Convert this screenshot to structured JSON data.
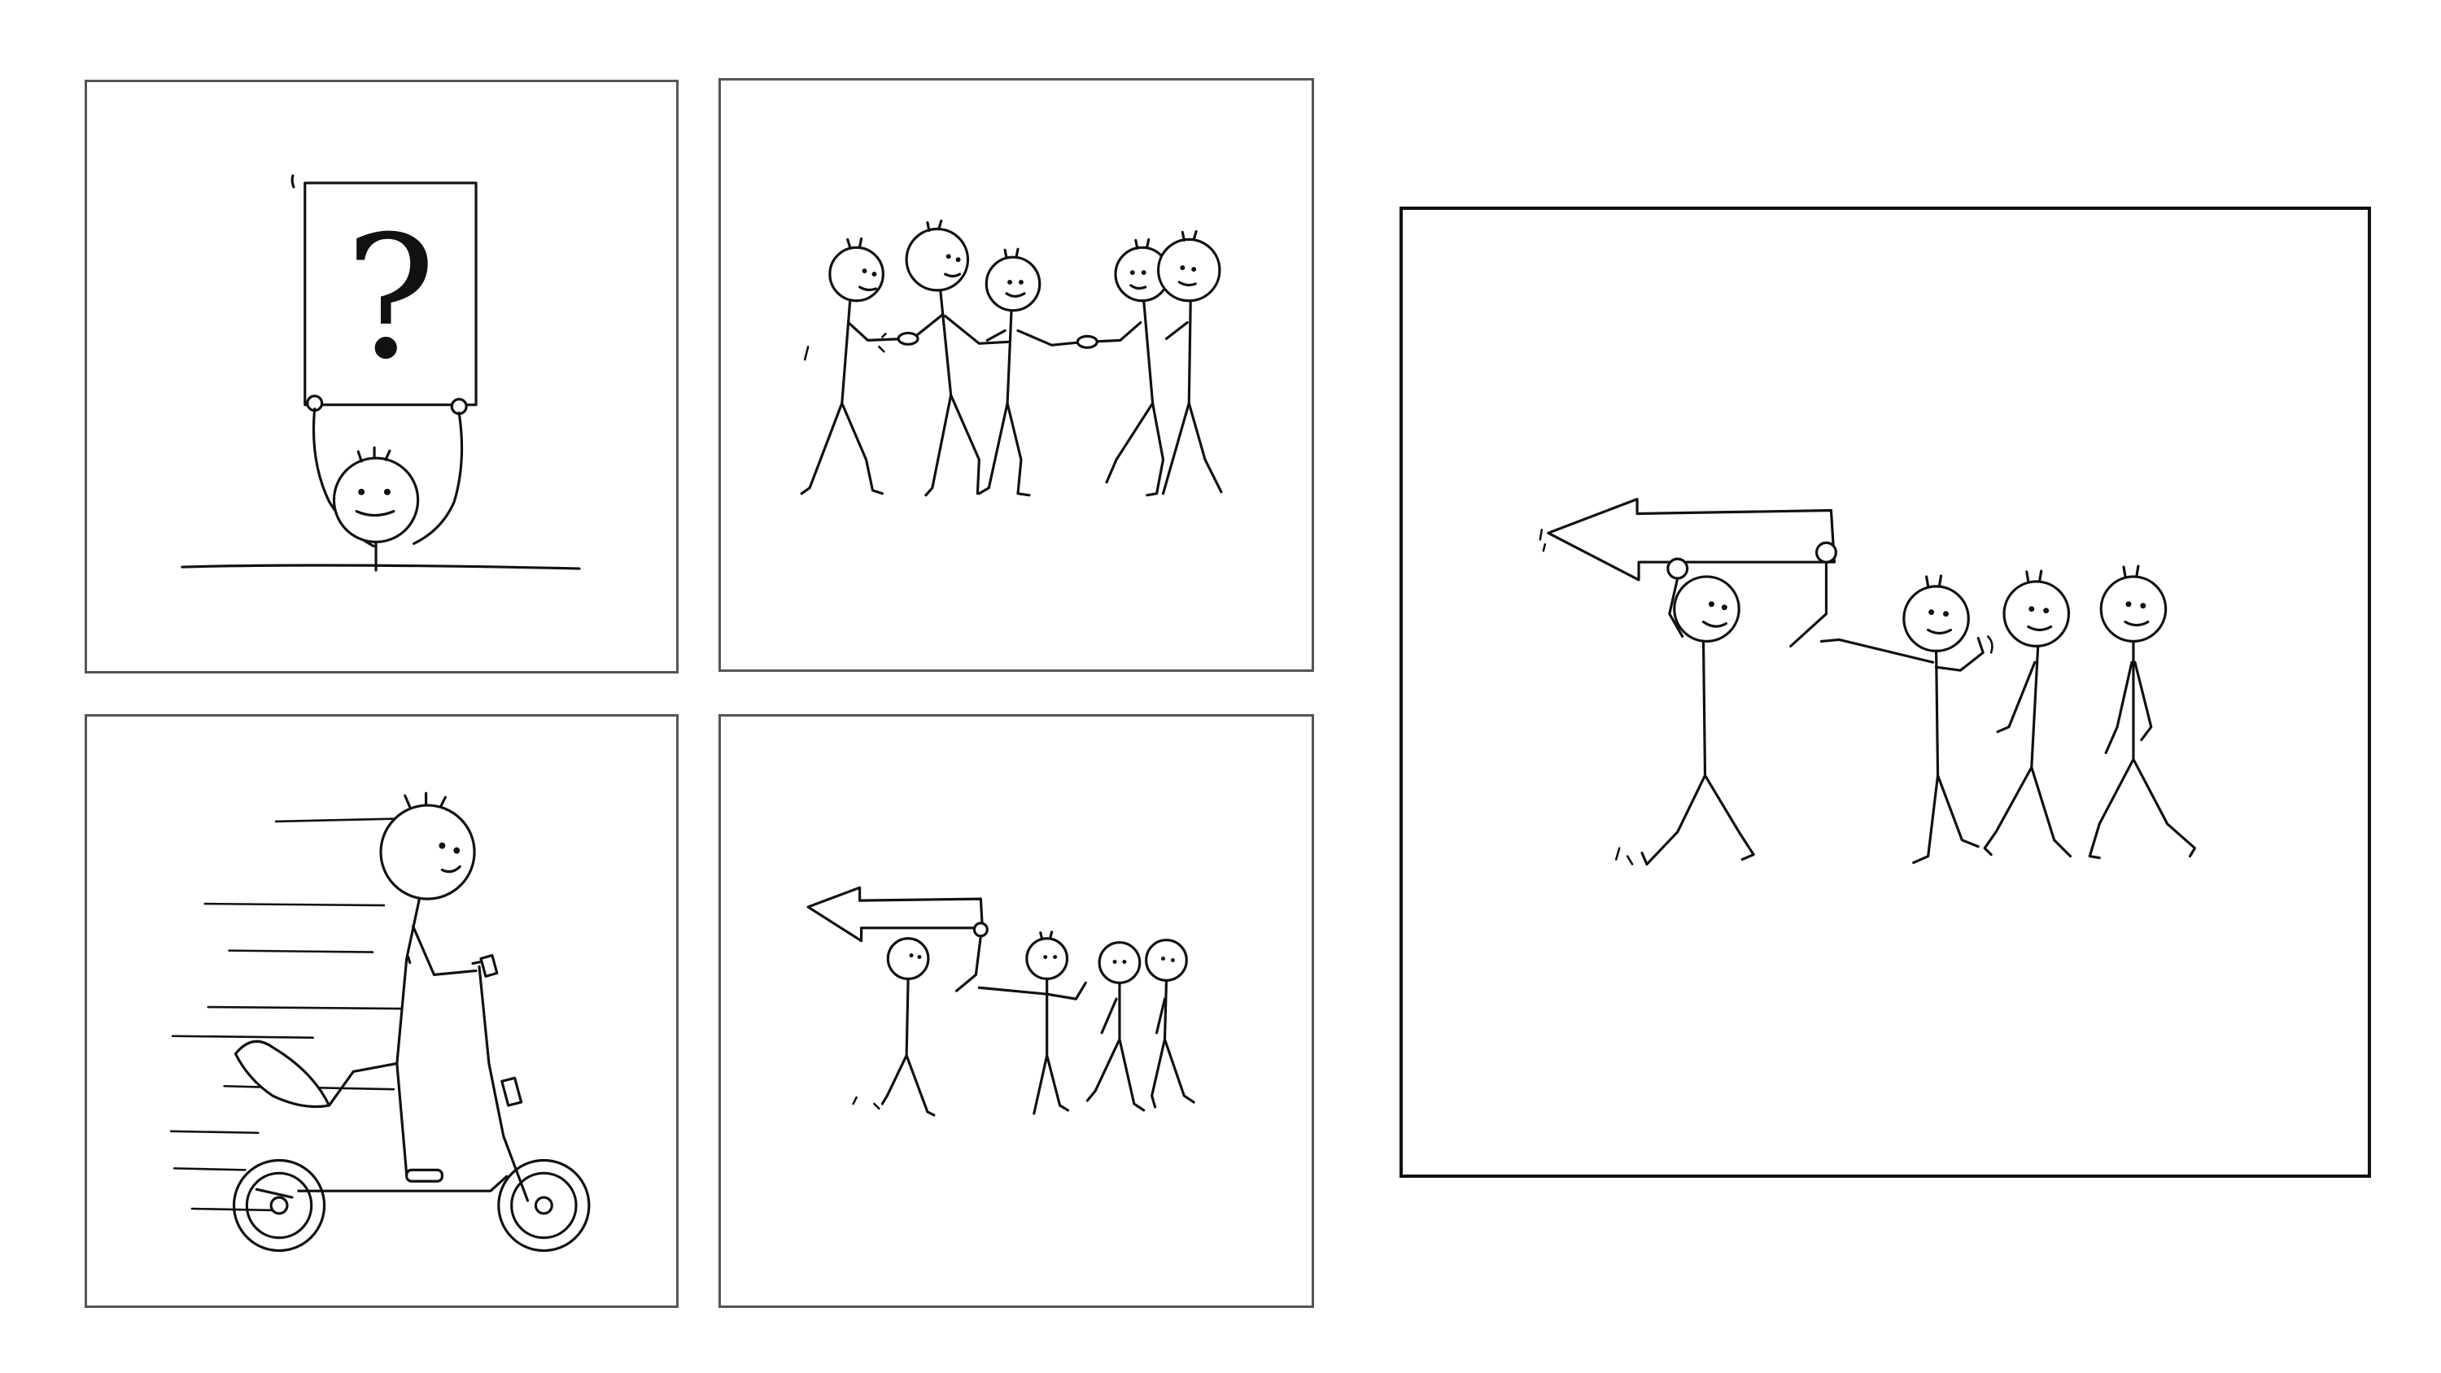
{
  "panels": [
    {
      "id": "question-sign",
      "sign_text": "?",
      "description_icon": "stick-figure-holding-sign-icon"
    },
    {
      "id": "group-holding-hands",
      "description_icon": "stick-figure-group-icon"
    },
    {
      "id": "scooter-rider",
      "description_icon": "stick-figure-scooter-icon"
    },
    {
      "id": "arrow-leader-small",
      "description_icon": "stick-figure-arrow-icon"
    },
    {
      "id": "arrow-leader-large",
      "description_icon": "stick-figure-arrow-icon"
    }
  ],
  "colors": {
    "ink": "#111111",
    "panel_border_small": "#555555",
    "panel_border_large": "#111111",
    "background": "#ffffff"
  }
}
